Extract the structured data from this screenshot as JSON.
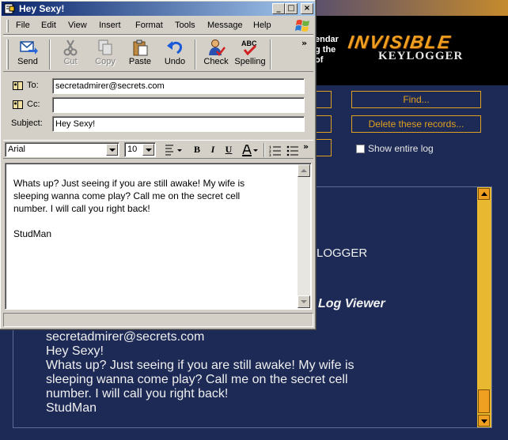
{
  "window": {
    "title": "Hey Sexy!",
    "controls": {
      "minimize": "_",
      "maximize": "□",
      "close": "×"
    }
  },
  "menu": [
    "File",
    "Edit",
    "View",
    "Insert",
    "Format",
    "Tools",
    "Message",
    "Help"
  ],
  "toolbar": {
    "send": "Send",
    "cut": "Cut",
    "copy": "Copy",
    "paste": "Paste",
    "undo": "Undo",
    "check": "Check",
    "spelling": "Spelling",
    "more": "»"
  },
  "headers": {
    "to_label": "To:",
    "to_value": "secretadmirer@secrets.com",
    "cc_label": "Cc:",
    "cc_value": "",
    "subject_label": "Subject:",
    "subject_value": "Hey Sexy!"
  },
  "format": {
    "font": "Arial",
    "size": "10",
    "more": "»"
  },
  "message_body": [
    "Whats up? Just seeing if you are still awake! My wife is",
    "sleeping wanna come play? Call me on the secret cell",
    "number. I will call you right back!",
    "",
    "StudMan"
  ],
  "keylogger": {
    "header_text": [
      "endar",
      "g the",
      "of"
    ],
    "logo_line1": "INVISIBLE",
    "logo_line2": "KEYLOGGER",
    "find_button": "Find...",
    "delete_button": "Delete these records...",
    "show_entire_log": "Show entire log",
    "logger_fragment": "LOGGER",
    "viewer_title": "Log Viewer",
    "log_lines": [
      "secretadmirer@secrets.com",
      "Hey Sexy!",
      "Whats up? Just seeing if you are still awake! My wife is",
      "sleeping wanna come play? Call me on the secret cell",
      "number. I will call you right back!",
      "StudMan"
    ]
  },
  "colors": {
    "keylogger_bg": "#1c2a55",
    "keylogger_accent": "#e0a020",
    "titlebar_active": "#0a246a",
    "window_face": "#d4d0c8"
  }
}
